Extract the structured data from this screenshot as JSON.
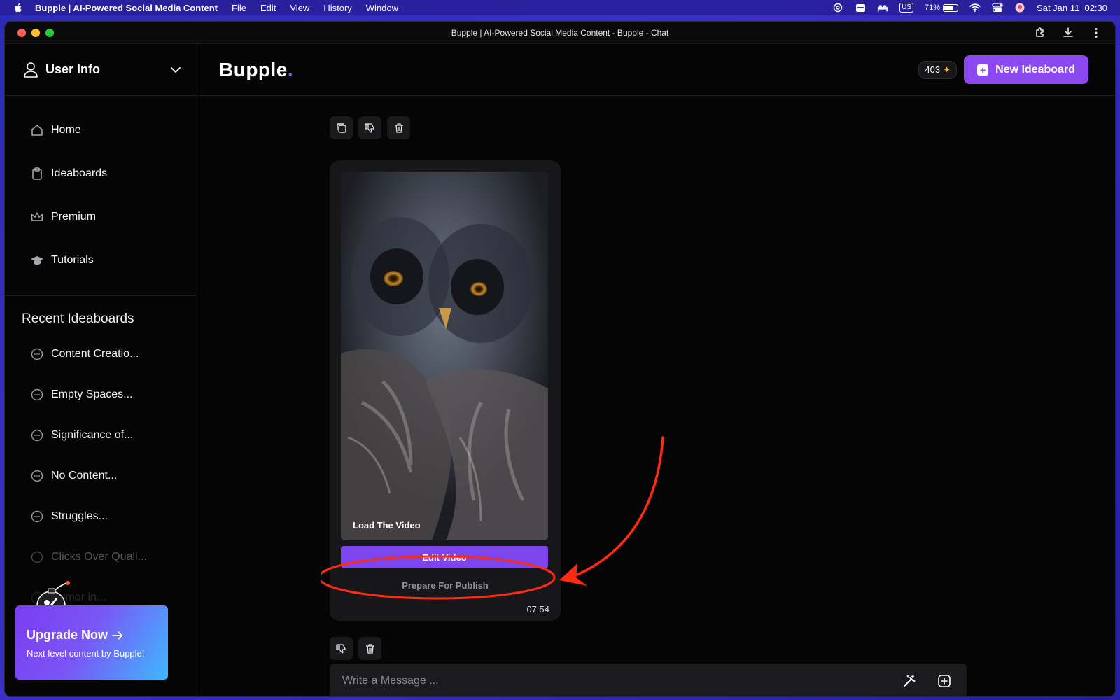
{
  "menubar": {
    "app_name": "Bupple | AI-Powered Social Media Content",
    "menus": [
      "File",
      "Edit",
      "View",
      "History",
      "Window"
    ],
    "keyboard": "US",
    "battery": "71%",
    "battery_level": 0.71,
    "datetime": "Sat Jan 11  02:30"
  },
  "window": {
    "title": "Bupple | AI-Powered Social Media Content - Bupple - Chat"
  },
  "sidebar": {
    "user_label": "User Info",
    "nav": [
      {
        "label": "Home",
        "icon": "home-icon"
      },
      {
        "label": "Ideaboards",
        "icon": "clipboard-icon"
      },
      {
        "label": "Premium",
        "icon": "crown-icon"
      },
      {
        "label": "Tutorials",
        "icon": "graduation-cap-icon"
      }
    ],
    "recent_title": "Recent Ideaboards",
    "recent": [
      "Content Creatio...",
      "Empty Spaces...",
      "Significance of...",
      "No Content...",
      "Struggles...",
      "Clicks Over Quali...",
      "Humor in..."
    ],
    "upgrade": {
      "title": "Upgrade Now",
      "subtitle": "Next level content by Bupple!"
    }
  },
  "header": {
    "brand": "Bupple",
    "brand_dot": ".",
    "credits": "403",
    "new_button": "New Ideaboard"
  },
  "card": {
    "load_label": "Load The Video",
    "edit_button": "Edit Video",
    "prepare_label": "Prepare For Publish",
    "duration": "07:54"
  },
  "composer": {
    "placeholder": "Write a Message ..."
  },
  "colors": {
    "accent": "#8b47f0",
    "annotation": "#ff2a12"
  }
}
